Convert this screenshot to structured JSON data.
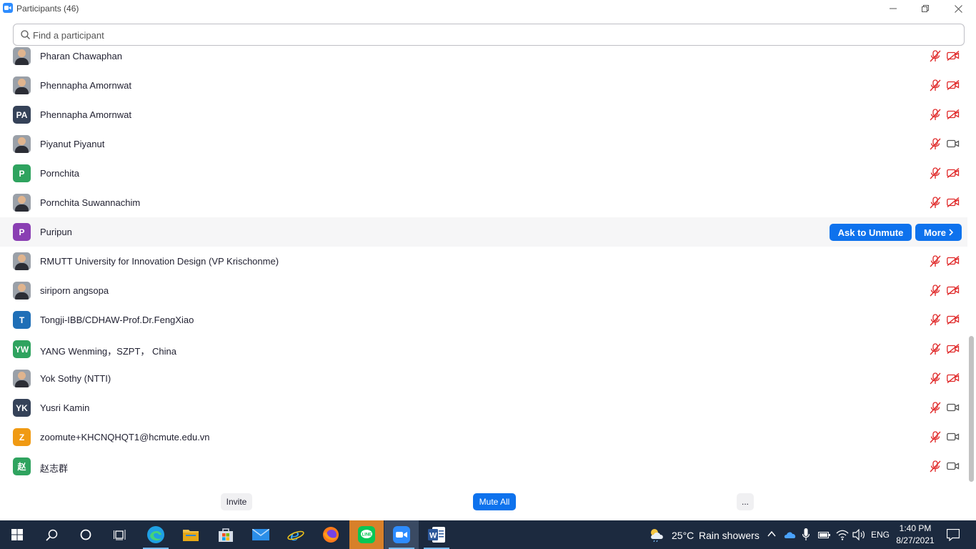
{
  "window": {
    "title": "Participants (46)"
  },
  "search": {
    "placeholder": "Find a participant",
    "value": ""
  },
  "participants": [
    {
      "name": "Pharan Chawaphan",
      "avatar_type": "photo",
      "mic": "muted",
      "video": "off"
    },
    {
      "name": "Phennapha Amornwat",
      "avatar_type": "photo",
      "mic": "muted",
      "video": "off"
    },
    {
      "name": "Phennapha Amornwat",
      "avatar_type": "initials",
      "initials": "PA",
      "color": "#354258",
      "mic": "muted",
      "video": "off"
    },
    {
      "name": "Piyanut Piyanut",
      "avatar_type": "photo",
      "mic": "muted",
      "video": "available"
    },
    {
      "name": "Pornchita",
      "avatar_type": "initials",
      "initials": "P",
      "color": "#2fa35f",
      "mic": "muted",
      "video": "off"
    },
    {
      "name": "Pornchita Suwannachim",
      "avatar_type": "photo",
      "mic": "muted",
      "video": "off"
    },
    {
      "name": "Puripun",
      "avatar_type": "initials",
      "initials": "P",
      "color": "#8a3fb3",
      "hovered": true
    },
    {
      "name": "RMUTT University for Innovation Design (VP Krischonme)",
      "avatar_type": "photo",
      "mic": "muted",
      "video": "off"
    },
    {
      "name": "siriporn angsopa",
      "avatar_type": "photo",
      "mic": "muted",
      "video": "off"
    },
    {
      "name": "Tongji-IBB/CDHAW-Prof.Dr.FengXiao",
      "avatar_type": "initials",
      "initials": "T",
      "color": "#1f6fb7",
      "mic": "muted",
      "video": "off"
    },
    {
      "name": "YANG Wenming，SZPT，  China",
      "avatar_type": "initials",
      "initials": "YW",
      "color": "#2fa35f",
      "mic": "muted",
      "video": "off"
    },
    {
      "name": "Yok Sothy (NTTI)",
      "avatar_type": "photo",
      "mic": "muted",
      "video": "off"
    },
    {
      "name": "Yusri Kamin",
      "avatar_type": "initials",
      "initials": "YK",
      "color": "#354258",
      "mic": "muted",
      "video": "available"
    },
    {
      "name": "zoomute+KHCNQHQT1@hcmute.edu.vn",
      "avatar_type": "initials",
      "initials": "Z",
      "color": "#f09a13",
      "mic": "muted",
      "video": "available"
    },
    {
      "name": "赵志群",
      "avatar_type": "initials",
      "initials": "赵",
      "color": "#2fa35f",
      "mic": "muted",
      "video": "available"
    }
  ],
  "row_actions": {
    "ask_to_unmute": "Ask to Unmute",
    "more": "More"
  },
  "footer": {
    "invite": "Invite",
    "mute_all": "Mute All",
    "more": "..."
  },
  "taskbar": {
    "apps": [
      "windows-start",
      "search",
      "cortana",
      "task-view",
      "edge",
      "file-explorer",
      "store",
      "mail",
      "internet-explorer",
      "firefox",
      "line",
      "zoom",
      "word"
    ],
    "weather": {
      "temp": "25°C",
      "condition": "Rain showers"
    },
    "language": "ENG",
    "time": "1:40 PM",
    "date": "8/27/2021"
  },
  "colors": {
    "accent": "#0e72ed",
    "muted_red": "#e02828",
    "taskbar_bg": "#1c2a3f"
  }
}
